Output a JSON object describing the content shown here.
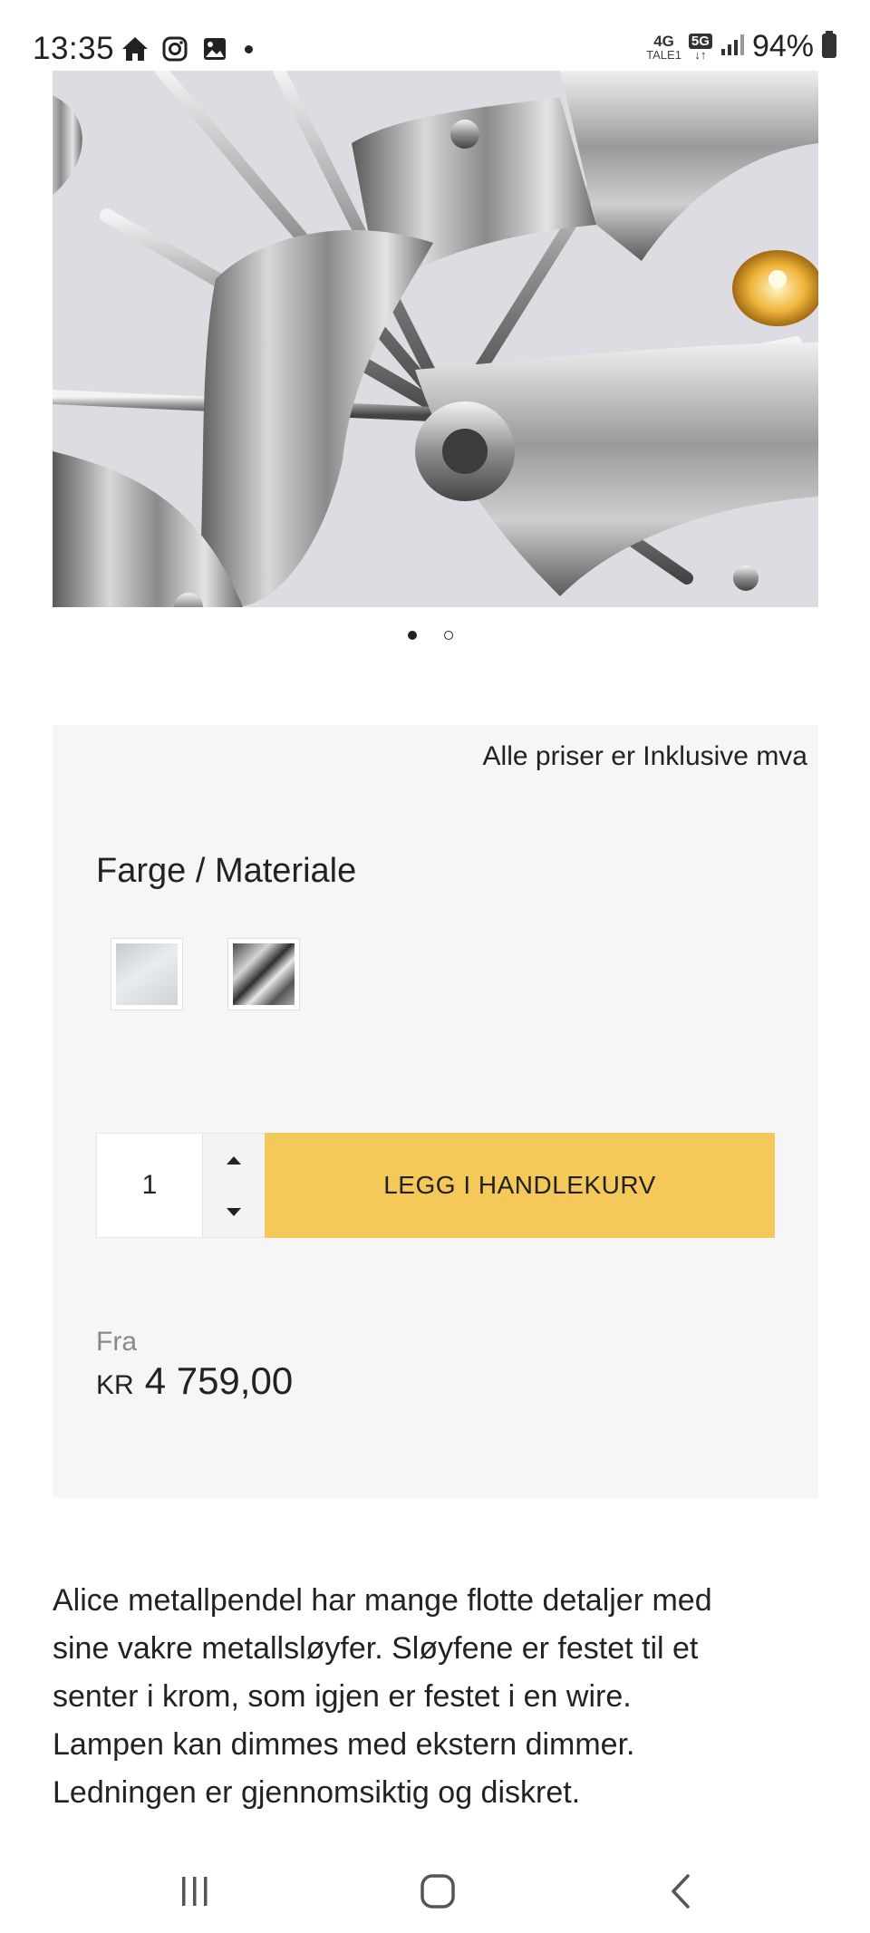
{
  "status_bar": {
    "time": "13:35",
    "network_4g": "4G",
    "network_tale": "TALE1",
    "network_5g": "5G",
    "battery": "94%"
  },
  "carousel": {
    "active_index": 0,
    "count": 2
  },
  "product": {
    "vat_note": "Alle priser er Inklusive mva",
    "option_title": "Farge / Materiale",
    "swatches": [
      "silver-swatch",
      "chrome-swatch"
    ],
    "quantity": "1",
    "add_to_cart_label": "LEGG I HANDLEKURV",
    "price_from_label": "Fra",
    "price_currency": "KR",
    "price_amount": "4 759,00",
    "accent_color": "#f5c85a"
  },
  "description": {
    "lines": [
      "Alice metallpendel har mange flotte detaljer med",
      "sine vakre metallsløyfer. Sløyfene er festet til et",
      "senter i krom, som igjen er festet i en wire.",
      "Lampen kan dimmes med ekstern dimmer.",
      "Ledningen er gjennomsiktig og diskret."
    ]
  }
}
